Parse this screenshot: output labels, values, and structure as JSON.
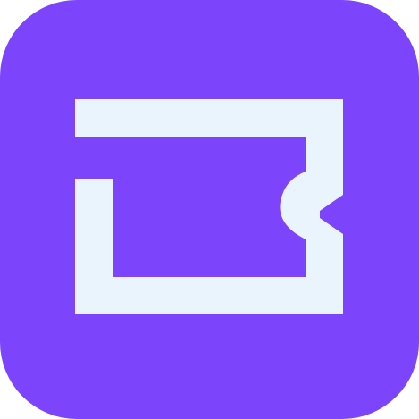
{
  "icon": {
    "name": "ticket-logo-icon",
    "background_color": "#7c44fb",
    "glyph_color": "#eaf4fd"
  }
}
